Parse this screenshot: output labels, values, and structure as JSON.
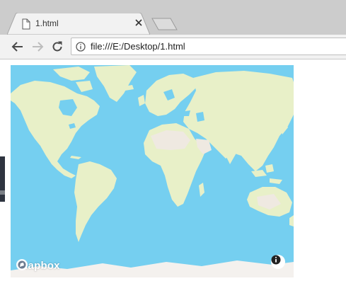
{
  "browser": {
    "tab": {
      "title": "1.html",
      "favicon": "document-icon",
      "close": "close-icon"
    },
    "new_tab": "new-tab-icon",
    "nav": {
      "back": "back-arrow-icon",
      "forward": "forward-arrow-icon",
      "reload": "reload-icon"
    },
    "address_bar": {
      "security_icon": "info-icon",
      "url": "file:///E:/Desktop/1.html"
    }
  },
  "page": {
    "map": {
      "provider_logo_text": "mapbox",
      "logo_icon": "mapbox-logo-icon",
      "attribution_icon": "info-icon",
      "colors": {
        "water": "#75cff0",
        "land": "#e8f0c8",
        "desert": "#efe9e1",
        "ice": "#f4f1ee"
      }
    }
  }
}
